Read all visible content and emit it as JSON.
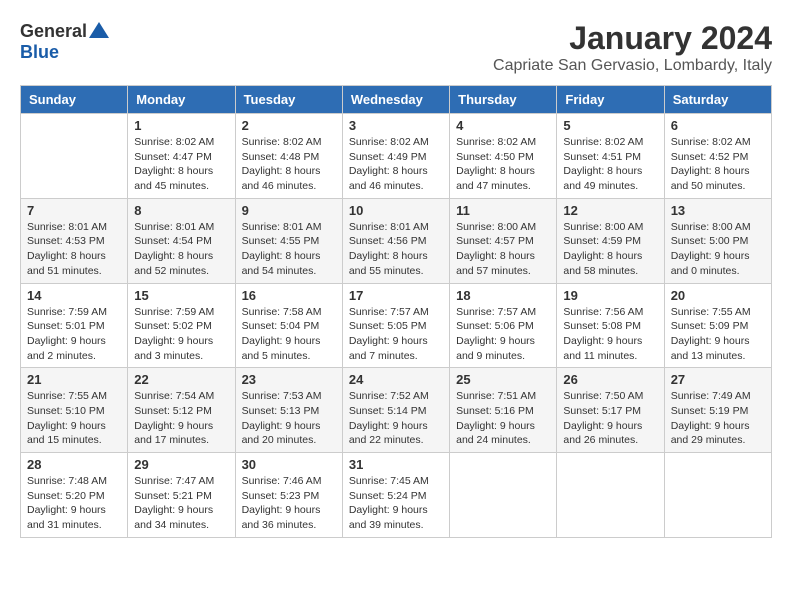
{
  "logo": {
    "general": "General",
    "blue": "Blue"
  },
  "title": "January 2024",
  "subtitle": "Capriate San Gervasio, Lombardy, Italy",
  "headers": [
    "Sunday",
    "Monday",
    "Tuesday",
    "Wednesday",
    "Thursday",
    "Friday",
    "Saturday"
  ],
  "weeks": [
    [
      {
        "day": "",
        "info": ""
      },
      {
        "day": "1",
        "info": "Sunrise: 8:02 AM\nSunset: 4:47 PM\nDaylight: 8 hours\nand 45 minutes."
      },
      {
        "day": "2",
        "info": "Sunrise: 8:02 AM\nSunset: 4:48 PM\nDaylight: 8 hours\nand 46 minutes."
      },
      {
        "day": "3",
        "info": "Sunrise: 8:02 AM\nSunset: 4:49 PM\nDaylight: 8 hours\nand 46 minutes."
      },
      {
        "day": "4",
        "info": "Sunrise: 8:02 AM\nSunset: 4:50 PM\nDaylight: 8 hours\nand 47 minutes."
      },
      {
        "day": "5",
        "info": "Sunrise: 8:02 AM\nSunset: 4:51 PM\nDaylight: 8 hours\nand 49 minutes."
      },
      {
        "day": "6",
        "info": "Sunrise: 8:02 AM\nSunset: 4:52 PM\nDaylight: 8 hours\nand 50 minutes."
      }
    ],
    [
      {
        "day": "7",
        "info": "Sunrise: 8:01 AM\nSunset: 4:53 PM\nDaylight: 8 hours\nand 51 minutes."
      },
      {
        "day": "8",
        "info": "Sunrise: 8:01 AM\nSunset: 4:54 PM\nDaylight: 8 hours\nand 52 minutes."
      },
      {
        "day": "9",
        "info": "Sunrise: 8:01 AM\nSunset: 4:55 PM\nDaylight: 8 hours\nand 54 minutes."
      },
      {
        "day": "10",
        "info": "Sunrise: 8:01 AM\nSunset: 4:56 PM\nDaylight: 8 hours\nand 55 minutes."
      },
      {
        "day": "11",
        "info": "Sunrise: 8:00 AM\nSunset: 4:57 PM\nDaylight: 8 hours\nand 57 minutes."
      },
      {
        "day": "12",
        "info": "Sunrise: 8:00 AM\nSunset: 4:59 PM\nDaylight: 8 hours\nand 58 minutes."
      },
      {
        "day": "13",
        "info": "Sunrise: 8:00 AM\nSunset: 5:00 PM\nDaylight: 9 hours\nand 0 minutes."
      }
    ],
    [
      {
        "day": "14",
        "info": "Sunrise: 7:59 AM\nSunset: 5:01 PM\nDaylight: 9 hours\nand 2 minutes."
      },
      {
        "day": "15",
        "info": "Sunrise: 7:59 AM\nSunset: 5:02 PM\nDaylight: 9 hours\nand 3 minutes."
      },
      {
        "day": "16",
        "info": "Sunrise: 7:58 AM\nSunset: 5:04 PM\nDaylight: 9 hours\nand 5 minutes."
      },
      {
        "day": "17",
        "info": "Sunrise: 7:57 AM\nSunset: 5:05 PM\nDaylight: 9 hours\nand 7 minutes."
      },
      {
        "day": "18",
        "info": "Sunrise: 7:57 AM\nSunset: 5:06 PM\nDaylight: 9 hours\nand 9 minutes."
      },
      {
        "day": "19",
        "info": "Sunrise: 7:56 AM\nSunset: 5:08 PM\nDaylight: 9 hours\nand 11 minutes."
      },
      {
        "day": "20",
        "info": "Sunrise: 7:55 AM\nSunset: 5:09 PM\nDaylight: 9 hours\nand 13 minutes."
      }
    ],
    [
      {
        "day": "21",
        "info": "Sunrise: 7:55 AM\nSunset: 5:10 PM\nDaylight: 9 hours\nand 15 minutes."
      },
      {
        "day": "22",
        "info": "Sunrise: 7:54 AM\nSunset: 5:12 PM\nDaylight: 9 hours\nand 17 minutes."
      },
      {
        "day": "23",
        "info": "Sunrise: 7:53 AM\nSunset: 5:13 PM\nDaylight: 9 hours\nand 20 minutes."
      },
      {
        "day": "24",
        "info": "Sunrise: 7:52 AM\nSunset: 5:14 PM\nDaylight: 9 hours\nand 22 minutes."
      },
      {
        "day": "25",
        "info": "Sunrise: 7:51 AM\nSunset: 5:16 PM\nDaylight: 9 hours\nand 24 minutes."
      },
      {
        "day": "26",
        "info": "Sunrise: 7:50 AM\nSunset: 5:17 PM\nDaylight: 9 hours\nand 26 minutes."
      },
      {
        "day": "27",
        "info": "Sunrise: 7:49 AM\nSunset: 5:19 PM\nDaylight: 9 hours\nand 29 minutes."
      }
    ],
    [
      {
        "day": "28",
        "info": "Sunrise: 7:48 AM\nSunset: 5:20 PM\nDaylight: 9 hours\nand 31 minutes."
      },
      {
        "day": "29",
        "info": "Sunrise: 7:47 AM\nSunset: 5:21 PM\nDaylight: 9 hours\nand 34 minutes."
      },
      {
        "day": "30",
        "info": "Sunrise: 7:46 AM\nSunset: 5:23 PM\nDaylight: 9 hours\nand 36 minutes."
      },
      {
        "day": "31",
        "info": "Sunrise: 7:45 AM\nSunset: 5:24 PM\nDaylight: 9 hours\nand 39 minutes."
      },
      {
        "day": "",
        "info": ""
      },
      {
        "day": "",
        "info": ""
      },
      {
        "day": "",
        "info": ""
      }
    ]
  ]
}
